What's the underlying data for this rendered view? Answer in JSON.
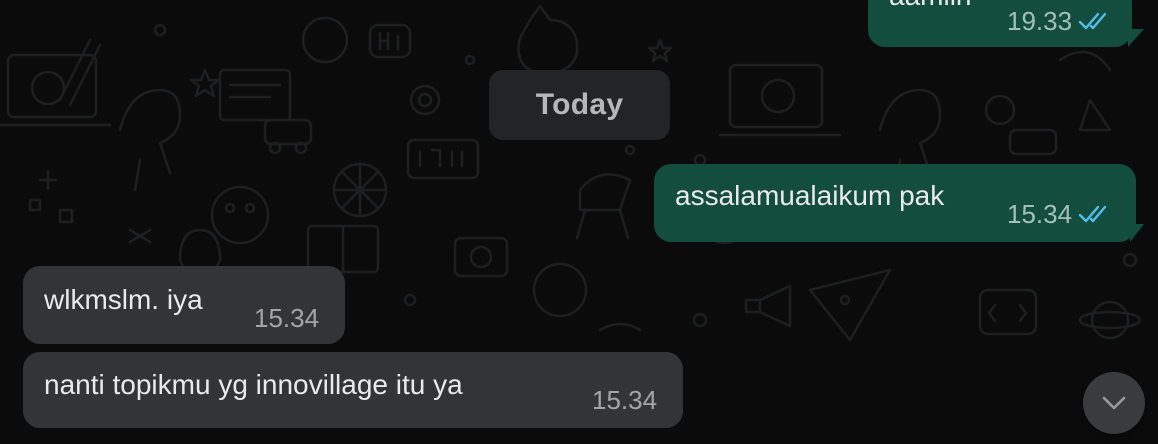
{
  "chat": {
    "date_separator": "Today",
    "messages": [
      {
        "direction": "outgoing",
        "text": "aamiin",
        "time": "19.33",
        "status": "read"
      },
      {
        "direction": "outgoing",
        "text": "assalamualaikum pak",
        "time": "15.34",
        "status": "read"
      },
      {
        "direction": "incoming",
        "text": "wlkmslm. iya",
        "time": "15.34"
      },
      {
        "direction": "incoming",
        "text": "nanti topikmu yg innovillage itu ya",
        "time": "15.34"
      }
    ]
  },
  "colors": {
    "background": "#0b0b0b",
    "doodle": "#1e1f20",
    "outgoing_bubble": "#134d3d",
    "incoming_bubble": "#333436",
    "read_tick": "#53bdeb",
    "date_pill": "#232425",
    "scroll_button": "#3a3b3d"
  },
  "icons": {
    "read_status": "double-check-icon",
    "scroll_down": "chevron-down-icon",
    "wallpaper": "doodle-pattern"
  }
}
